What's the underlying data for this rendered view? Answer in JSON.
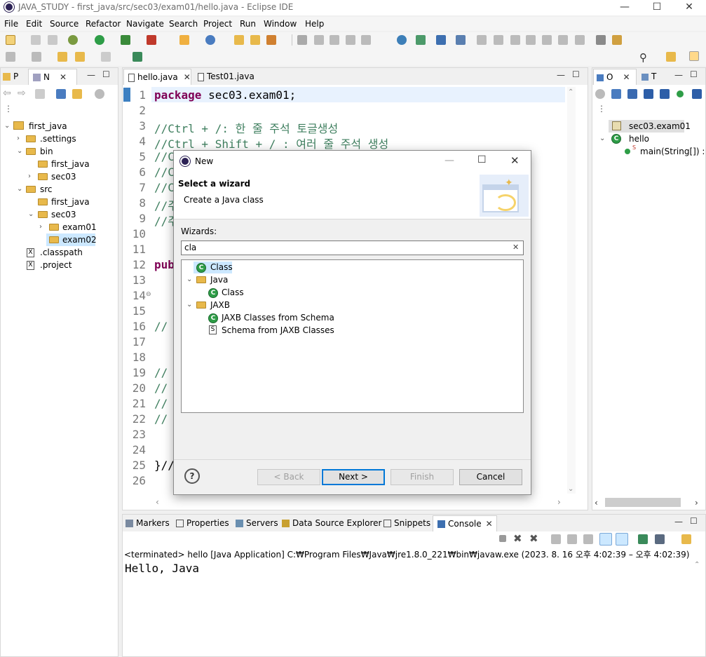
{
  "window": {
    "title": "JAVA_STUDY - first_java/src/sec03/exam01/hello.java - Eclipse IDE",
    "minimize": "—",
    "maximize": "☐",
    "close": "✕"
  },
  "menu": [
    "File",
    "Edit",
    "Source",
    "Refactor",
    "Navigate",
    "Search",
    "Project",
    "Run",
    "Window",
    "Help"
  ],
  "left_panel": {
    "tabs": [
      {
        "label": "P"
      },
      {
        "label": "N"
      }
    ],
    "tree": [
      {
        "label": "first_java"
      },
      {
        "label": ".settings"
      },
      {
        "label": "bin"
      },
      {
        "label": "first_java"
      },
      {
        "label": "sec03"
      },
      {
        "label": "src"
      },
      {
        "label": "first_java"
      },
      {
        "label": "sec03"
      },
      {
        "label": "exam01"
      },
      {
        "label": "exam02"
      },
      {
        "label": ".classpath"
      },
      {
        "label": ".project"
      }
    ]
  },
  "editor": {
    "tabs": [
      {
        "label": "hello.java"
      },
      {
        "label": "Test01.java"
      }
    ],
    "line_numbers": [
      "1",
      "2",
      "3",
      "4",
      "5",
      "6",
      "7",
      "8",
      "9",
      "10",
      "11",
      "12",
      "13",
      "14",
      "15",
      "16",
      "17",
      "18",
      "19",
      "20",
      "21",
      "22",
      "23",
      "24",
      "25",
      "26"
    ],
    "lines": {
      "l1_kw": "package",
      "l1_rest": " sec03.exam01;",
      "l3": "//Ctrl + /: 한 줄 주석 토글생성",
      "l4": "//Ctrl + Shift + / : 여러 줄 주석 생성",
      "l5": "//C",
      "l6": "//C",
      "l7": "//C",
      "l8": "//주",
      "l9": "//주",
      "l12": "pub",
      "l16": "// ",
      "l19": "// ",
      "l20": "// ",
      "l21": "// ",
      "l22": "// ",
      "l25": "}//"
    }
  },
  "outline_panel": {
    "tabs": [
      {
        "label": "O"
      },
      {
        "label": "T"
      }
    ],
    "items": [
      {
        "label": "sec03.exam01"
      },
      {
        "label": "hello"
      },
      {
        "label": "main(String[]) : v"
      }
    ]
  },
  "dialog": {
    "title": "New",
    "header": "Select a wizard",
    "subheader": "Create a Java class",
    "wizards_label": "Wizards:",
    "filter_value": "cla",
    "clear": "✕",
    "tree": [
      {
        "label": "Class"
      },
      {
        "label": "Java"
      },
      {
        "label": "Class"
      },
      {
        "label": "JAXB"
      },
      {
        "label": "JAXB Classes from Schema"
      },
      {
        "label": "Schema from JAXB Classes"
      }
    ],
    "help": "?",
    "buttons": {
      "back": "< Back",
      "next": "Next >",
      "finish": "Finish",
      "cancel": "Cancel"
    }
  },
  "bottom_panel": {
    "tabs": [
      {
        "label": "Markers"
      },
      {
        "label": "Properties"
      },
      {
        "label": "Servers"
      },
      {
        "label": "Data Source Explorer"
      },
      {
        "label": "Snippets"
      },
      {
        "label": "Console"
      }
    ],
    "status": "<terminated> hello [Java Application] C:₩Program Files₩Java₩jre1.8.0_221₩bin₩javaw.exe  (2023. 8. 16 오후 4:02:39 – 오후 4:02:39)",
    "output": "Hello, Java"
  },
  "colors": {
    "keyword": "#7f0055",
    "comment": "#3f7f5f",
    "selection": "#cce8ff",
    "accent": "#0078d7"
  }
}
